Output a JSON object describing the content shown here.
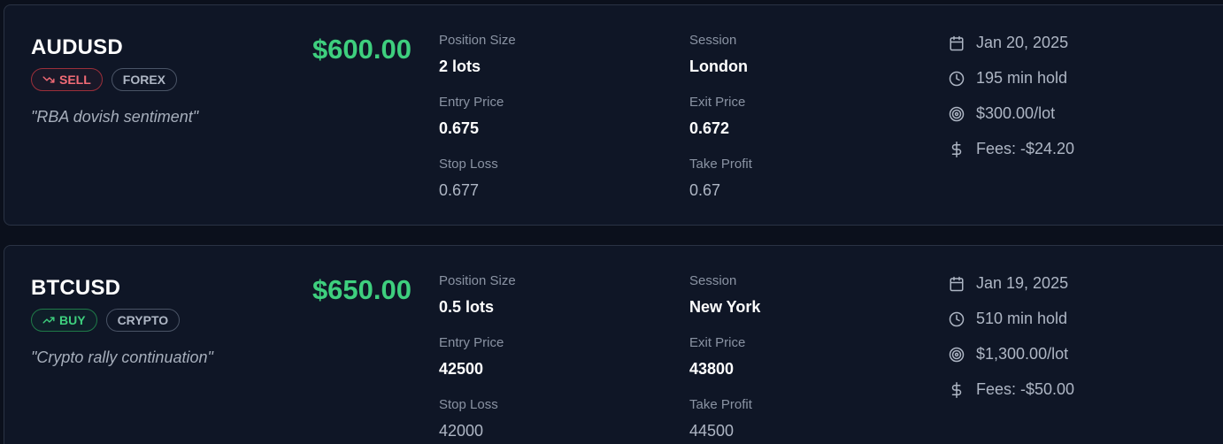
{
  "trades": [
    {
      "symbol": "AUDUSD",
      "direction": "SELL",
      "category": "FOREX",
      "note": "\"RBA dovish sentiment\"",
      "pnl": "$600.00",
      "fields": {
        "position_size": {
          "label": "Position Size",
          "value": "2 lots"
        },
        "session": {
          "label": "Session",
          "value": "London"
        },
        "entry_price": {
          "label": "Entry Price",
          "value": "0.675"
        },
        "exit_price": {
          "label": "Exit Price",
          "value": "0.672"
        },
        "stop_loss": {
          "label": "Stop Loss",
          "value": "0.677"
        },
        "take_profit": {
          "label": "Take Profit",
          "value": "0.67"
        }
      },
      "meta": {
        "date": "Jan 20, 2025",
        "hold": "195 min hold",
        "per_lot": "$300.00/lot",
        "fees": "Fees: -$24.20"
      }
    },
    {
      "symbol": "BTCUSD",
      "direction": "BUY",
      "category": "CRYPTO",
      "note": "\"Crypto rally continuation\"",
      "pnl": "$650.00",
      "fields": {
        "position_size": {
          "label": "Position Size",
          "value": "0.5 lots"
        },
        "session": {
          "label": "Session",
          "value": "New York"
        },
        "entry_price": {
          "label": "Entry Price",
          "value": "42500"
        },
        "exit_price": {
          "label": "Exit Price",
          "value": "43800"
        },
        "stop_loss": {
          "label": "Stop Loss",
          "value": "42000"
        },
        "take_profit": {
          "label": "Take Profit",
          "value": "44500"
        }
      },
      "meta": {
        "date": "Jan 19, 2025",
        "hold": "510 min hold",
        "per_lot": "$1,300.00/lot",
        "fees": "Fees: -$50.00"
      }
    }
  ],
  "icons": {
    "sell": "trending-down-icon",
    "buy": "trending-up-icon",
    "date": "calendar-icon",
    "hold": "clock-icon",
    "per_lot": "target-icon",
    "fees": "dollar-sign-icon"
  },
  "colors": {
    "background": "#0b101c",
    "card": "#0f1626",
    "profit": "#3ecf7e",
    "sell": "#f26b76",
    "buy": "#3ecf7e"
  }
}
